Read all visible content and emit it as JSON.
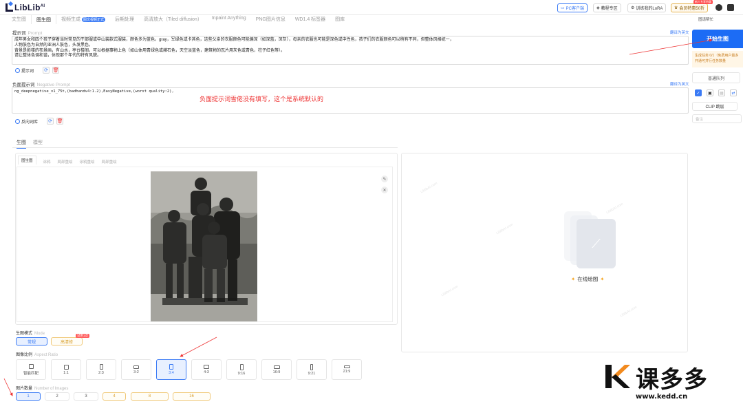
{
  "app": {
    "brand_name": "LibLib",
    "brand_sup": "AI"
  },
  "header": {
    "pc_client": "PC客户端",
    "tutorial": "教程专区",
    "train_lora": "训练我的LoRA",
    "vip": "会员特惠50折",
    "vip_tag": "新人专享特惠"
  },
  "tabs": [
    {
      "label": "文生图"
    },
    {
      "label": "图生图"
    },
    {
      "label": "视频生成",
      "tag": "图文视频正式"
    },
    {
      "label": "后期处理"
    },
    {
      "label": "高清放大（Tiled diffusion）"
    },
    {
      "label": "Inpaint Anything"
    },
    {
      "label": "PNG图片信息"
    },
    {
      "label": "WD1.4 标签器"
    },
    {
      "label": "图库"
    }
  ],
  "prompt": {
    "label": "提示词",
    "label_en": "Prompt",
    "translate": "翻译为英文",
    "lines": [
      "成年男女和四个孩子穿着当时常见的干部服或中山装款式服装，颜色多为蓝色，gray，军绿色或卡其色，这些父亲的衣服颜色可能偏深（如深蓝，深灰），母亲的衣服也可能是深色或中性色，孩子们的衣服颜色可以稍有不同，但整体风格统一，",
      "人物肤色为自然的亚洲人肤色，头发黑色，",
      "背景是影楼的布景画，有山水，亭台楼阁，可以根据事物上色（如山体用青绿色或赭石色，天空淡蓝色，建筑物的瓦片用灰色或青色，柱子红色等）。",
      "请让整体色调和谐，体现那个年代的特有风貌。"
    ],
    "sub_label": "提示词"
  },
  "negative": {
    "label": "负面提示词",
    "label_en": "Negative Prompt",
    "translate": "翻译为英文",
    "text": "ng_deepnegative_v1_75t,(badhandv4:1.2),EasyNegative,(worst quality:2),",
    "note": "负面提示词雪佬没有填写，这个是系统默认的",
    "sub_label": "反向词库"
  },
  "gen_tabs": [
    {
      "label": "生图"
    },
    {
      "label": "模型"
    }
  ],
  "img_tabs": [
    {
      "label": "图生图"
    },
    {
      "label": "涂鸦"
    },
    {
      "label": "局部重绘"
    },
    {
      "label": "涂鸦重绘"
    },
    {
      "label": "局部重绘"
    }
  ],
  "mode": {
    "label": "生图模式",
    "label_en": "Mode",
    "options": [
      {
        "label": "常规"
      },
      {
        "label": "高清修"
      }
    ],
    "trial_tag": "试用1次"
  },
  "aspect": {
    "label": "图像比例",
    "label_en": "Aspect Ratio",
    "options": [
      {
        "label": "智能匹配"
      },
      {
        "label": "1:1"
      },
      {
        "label": "2:3"
      },
      {
        "label": "3:2"
      },
      {
        "label": "3:4"
      },
      {
        "label": "4:3"
      },
      {
        "label": "9:16"
      },
      {
        "label": "16:9"
      },
      {
        "label": "9:21"
      },
      {
        "label": "21:9"
      }
    ],
    "selected": "3:4"
  },
  "count": {
    "label": "图片数量",
    "label_en": "Number of Images",
    "options": [
      "1",
      "2",
      "3",
      "4",
      "8",
      "16"
    ],
    "selected": "1"
  },
  "right": {
    "start_button": "开始生图",
    "task_line1": "生成任务 0/1（免费用户最多",
    "task_line2": "开通可并行任务数量",
    "top_link": "图请帮忙",
    "queue": "普通队列",
    "clip": "CLIP 跳层",
    "memo_placeholder": "备注"
  },
  "result": {
    "online_draw": "在线绘图"
  },
  "watermark": {
    "brand_cn": "课多多",
    "url": "www.kedd.cn"
  },
  "colors": {
    "accent": "#3b7bf5",
    "start_button": "#1c6cf5",
    "note_red": "#e33333",
    "gold": "#e6b450"
  }
}
